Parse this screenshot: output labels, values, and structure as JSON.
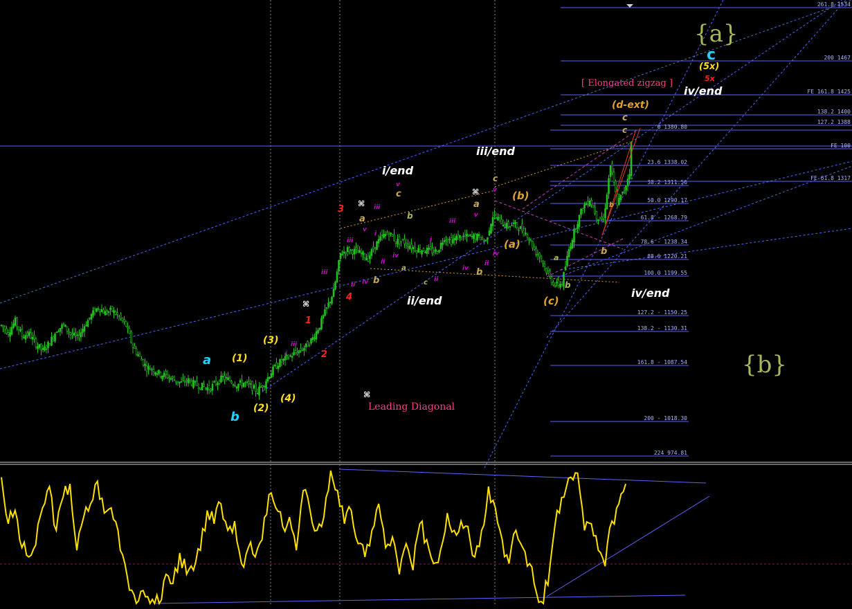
{
  "colors": {
    "background": "#000000",
    "candle_up": "#22c21f",
    "candle_down": "#22c21f",
    "fib_line": "#5a63ff",
    "channel": "#5a7dff",
    "oscillator": "#ffe100",
    "cyan_label": "#23d1ff",
    "yellow_label": "#ffdf22",
    "magenta_label": "#d000d0",
    "red_label": "#ff2020",
    "tan_label": "#c7a75a",
    "orange_label": "#e0a030",
    "olive_label": "#a7b75a",
    "pink_text": "#ff3a8a",
    "white_label": "#ffffff"
  },
  "fib_levels": [
    {
      "label": "261.8 1534"
    },
    {
      "label": "200 1467"
    },
    {
      "label": "FE 161.8 1425"
    },
    {
      "label": "138.2 1400"
    },
    {
      "label": "127.2 1388"
    },
    {
      "label": "0 1380.80"
    },
    {
      "label": "FE 100"
    },
    {
      "label": "23.6 1338.02"
    },
    {
      "label": "38.2 1311.56"
    },
    {
      "label": "FE 61.8 1317"
    },
    {
      "label": "50.0 1290.17"
    },
    {
      "label": "61.8 - 1268.79"
    },
    {
      "label": "78.6 - 1238.34"
    },
    {
      "label": "88.6 1220.21"
    },
    {
      "label": "100.0 1199.55"
    },
    {
      "label": "127.2 - 1150.25"
    },
    {
      "label": "138.2 - 1130.31"
    },
    {
      "label": "161.8 - 1087.54"
    },
    {
      "label": "200 - 1018.30"
    },
    {
      "label": "224 974.81"
    }
  ],
  "wave_labels": {
    "a_big": "{a}",
    "b_big": "{b}",
    "c_top": "c",
    "fivex_paren": "(5x)",
    "fivex_red": "5x",
    "elongated_zigzag": "[ Elongated zigzag ]",
    "iv_end_top": "iv/end",
    "d_ext": "(d-ext)",
    "c_small": "c",
    "c_small2": "c",
    "iii_end": "iii/end",
    "i_end": "i/end",
    "ii_end": "ii/end",
    "iv_end_low": "iv/end",
    "b_paren": "(b)",
    "a_paren": "(a)",
    "c_paren": "(c)",
    "leading_diagonal": "Leading Diagonal",
    "a_cyan": "a",
    "b_cyan": "b",
    "w1": "(1)",
    "w2": "(2)",
    "w3": "(3)",
    "w4": "(4)",
    "r1": "1",
    "r2": "2",
    "r3": "3",
    "r4": "4",
    "sym1": "⌘",
    "sym2": "⌘",
    "sym3": "⌘",
    "sym4": "⌘",
    "a1": "a",
    "b1": "b",
    "c1": "c",
    "a2": "a",
    "b2": "b",
    "c2": "c",
    "a3": "a",
    "b3": "b",
    "a4": "a",
    "b4": "b",
    "c4": "c",
    "b5": "b",
    "b6": "b",
    "iii_m1": "iii",
    "iii_m2": "iii",
    "iii_m3": "iii",
    "iii_m4": "iii",
    "iv_m1": "iv",
    "iv_m2": "iv",
    "iv_m3": "iv",
    "iv_m4": "iv",
    "ii_m1": "ii",
    "ii_m2": "ii",
    "ii_m3": "ii",
    "ii_m4": "ii",
    "i_m1": "i",
    "i_m2": "i",
    "i_m3": "i",
    "v_m1": "v",
    "v_m2": "v",
    "v_m3": "v",
    "v_m4": "v"
  },
  "chart_data": {
    "type": "line",
    "title": "",
    "price_series": {
      "x": [
        0,
        10,
        20,
        30,
        40,
        50,
        60,
        70,
        80,
        90,
        100,
        110,
        120,
        130,
        140,
        150,
        160,
        170,
        180,
        190,
        200,
        210,
        220,
        230,
        240,
        250,
        260,
        270,
        280,
        290,
        300,
        310,
        320,
        330,
        340,
        350,
        360,
        370,
        380,
        390,
        400,
        410,
        420,
        430,
        440,
        450,
        460,
        470,
        480,
        490,
        500,
        510,
        520,
        530,
        540,
        550,
        560,
        570,
        580,
        590,
        600,
        610,
        620,
        630,
        640,
        650,
        660,
        670,
        680,
        690,
        700,
        710,
        720,
        730,
        740,
        750,
        760,
        770,
        780,
        790,
        800,
        810,
        820,
        830,
        840,
        850,
        860,
        870,
        880,
        890,
        900,
        910
      ],
      "y": [
        1150,
        1142,
        1155,
        1138,
        1140,
        1128,
        1120,
        1130,
        1145,
        1150,
        1140,
        1135,
        1150,
        1162,
        1172,
        1165,
        1168,
        1160,
        1150,
        1125,
        1112,
        1100,
        1098,
        1092,
        1090,
        1085,
        1082,
        1085,
        1080,
        1078,
        1075,
        1082,
        1088,
        1085,
        1080,
        1082,
        1078,
        1072,
        1082,
        1095,
        1105,
        1110,
        1115,
        1120,
        1125,
        1135,
        1150,
        1170,
        1190,
        1235,
        1240,
        1238,
        1235,
        1230,
        1245,
        1255,
        1260,
        1250,
        1250,
        1245,
        1240,
        1240,
        1238,
        1238,
        1255,
        1250,
        1255,
        1255,
        1255,
        1255,
        1250,
        1280,
        1275,
        1268,
        1270,
        1265,
        1258,
        1240,
        1230,
        1210,
        1198,
        1200,
        1240,
        1268,
        1290,
        1300,
        1280,
        1275,
        1340,
        1295,
        1310,
        1340,
        1365
      ]
    },
    "oscillator_series": {
      "x": [
        0,
        10,
        20,
        30,
        40,
        50,
        60,
        70,
        80,
        90,
        100,
        110,
        120,
        130,
        140,
        150,
        160,
        170,
        180,
        190,
        200,
        210,
        220,
        230,
        240,
        250,
        260,
        270,
        280,
        290,
        300,
        310,
        320,
        330,
        340,
        350,
        360,
        370,
        380,
        390,
        400,
        410,
        420,
        430,
        440,
        450,
        460,
        470,
        480,
        490,
        500,
        510,
        520,
        530,
        540,
        550,
        560,
        570,
        580,
        590,
        600,
        610,
        620,
        630,
        640,
        650,
        660,
        670,
        680,
        690,
        700,
        710,
        720,
        730,
        740,
        750,
        760,
        770,
        780,
        790,
        800,
        810,
        820,
        830,
        840,
        850,
        860,
        870,
        880,
        890,
        900,
        910
      ],
      "y": [
        95,
        60,
        70,
        42,
        35,
        44,
        72,
        88,
        55,
        80,
        90,
        40,
        65,
        75,
        92,
        68,
        72,
        55,
        30,
        10,
        2,
        5,
        3,
        0,
        22,
        15,
        38,
        22,
        25,
        40,
        70,
        60,
        75,
        55,
        62,
        30,
        42,
        35,
        48,
        82,
        72,
        58,
        65,
        40,
        85,
        70,
        55,
        65,
        100,
        85,
        60,
        70,
        45,
        35,
        55,
        75,
        42,
        50,
        22,
        45,
        25,
        60,
        48,
        30,
        40,
        68,
        55,
        62,
        58,
        35,
        55,
        88,
        72,
        48,
        30,
        55,
        42,
        30,
        8,
        0,
        30,
        70,
        80,
        95,
        98,
        55,
        60,
        40,
        28,
        62,
        75,
        80,
        90
      ]
    }
  }
}
